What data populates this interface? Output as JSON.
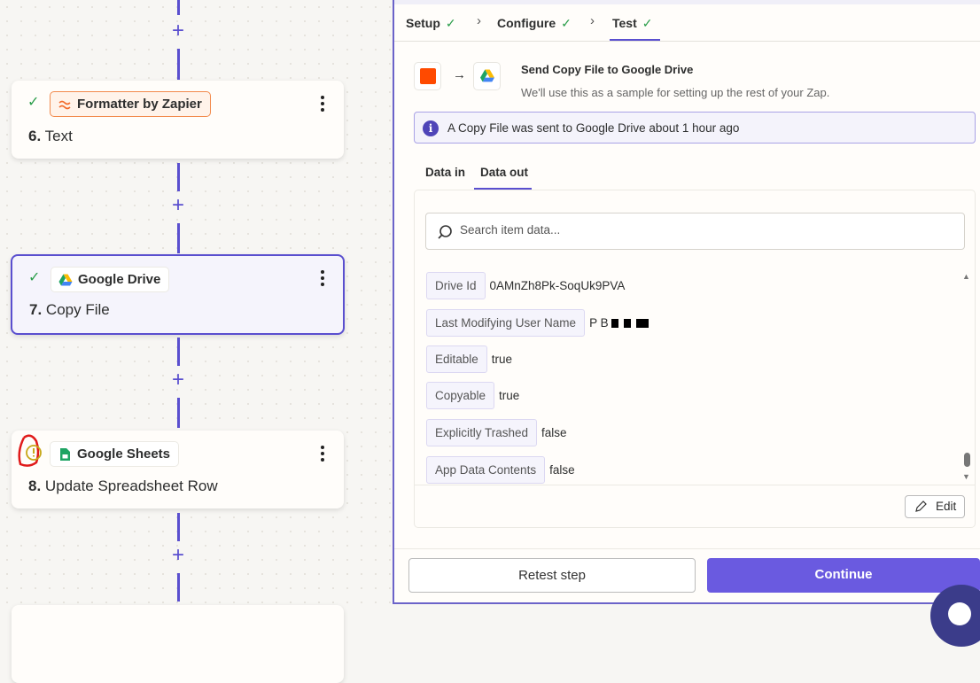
{
  "canvas": {
    "steps": [
      {
        "status": "check",
        "app": "Formatter by Zapier",
        "number": "6.",
        "title": "Text"
      },
      {
        "status": "check",
        "app": "Google Drive",
        "number": "7.",
        "title": "Copy File",
        "selected": true
      },
      {
        "status": "warning",
        "app": "Google Sheets",
        "number": "8.",
        "title": "Update Spreadsheet Row"
      }
    ]
  },
  "panel": {
    "tabs": [
      {
        "label": "Setup"
      },
      {
        "label": "Configure"
      },
      {
        "label": "Test",
        "active": true
      }
    ],
    "header": {
      "title": "Send Copy File to Google Drive",
      "subtitle": "We'll use this as a sample for setting up the rest of your Zap."
    },
    "info": "A Copy File was sent to Google Drive about 1 hour ago",
    "data_tabs": [
      {
        "label": "Data in"
      },
      {
        "label": "Data out",
        "active": true
      }
    ],
    "search_placeholder": "Search item data...",
    "fields": [
      {
        "key": "Drive Id",
        "value": "0AMnZh8Pk-SoqUk9PVA"
      },
      {
        "key": "Last Modifying User Name",
        "value": "P  B"
      },
      {
        "key": "Editable",
        "value": "true"
      },
      {
        "key": "Copyable",
        "value": "true"
      },
      {
        "key": "Explicitly Trashed",
        "value": "false"
      },
      {
        "key": "App Data Contents",
        "value": "false"
      }
    ],
    "edit_label": "Edit",
    "retest_label": "Retest step",
    "continue_label": "Continue"
  },
  "colors": {
    "accent": "#5a4fcf",
    "continue": "#6a5ae0",
    "success": "#2a9d4a",
    "formatter": "#f28a4c"
  }
}
